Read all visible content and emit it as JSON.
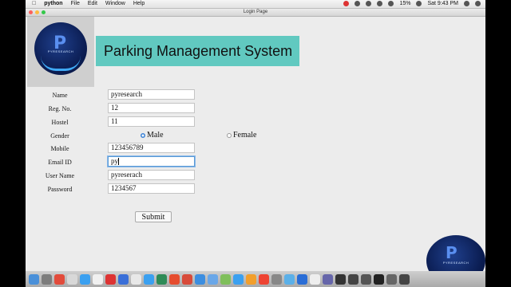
{
  "menubar": {
    "app": "python",
    "menus": [
      "File",
      "Edit",
      "Window",
      "Help"
    ],
    "battery": "15%",
    "clock": "Sat 9:43 PM"
  },
  "window": {
    "title": "Login Page"
  },
  "logo": {
    "letter": "P",
    "text": "PYRESEARCH"
  },
  "banner": {
    "title": "Parking Management System"
  },
  "form": {
    "name": {
      "label": "Name",
      "value": "pyresearch"
    },
    "regno": {
      "label": "Reg. No.",
      "value": "12"
    },
    "hostel": {
      "label": "Hostel",
      "value": "11"
    },
    "gender": {
      "label": "Gender",
      "options": [
        "Male",
        "Female"
      ],
      "selected": "Male"
    },
    "mobile": {
      "label": "Mobile",
      "value": "123456789"
    },
    "email": {
      "label": "Email ID",
      "value": "py"
    },
    "username": {
      "label": "User Name",
      "value": "pyreserach"
    },
    "password": {
      "label": "Password",
      "value": "1234567"
    },
    "submit_label": "Submit"
  },
  "dock": {
    "colors": [
      "#4a90d9",
      "#7d7d7d",
      "#e24b3b",
      "#d8d8d8",
      "#3ba0f0",
      "#f0f0f0",
      "#d33",
      "#3a6fd8",
      "#e8e8e8",
      "#3ba0f0",
      "#2e8b57",
      "#e64d2f",
      "#d84b3a",
      "#3c8ee0",
      "#6aa7e8",
      "#7fbf5b",
      "#3ba0f0",
      "#f29f2c",
      "#e43",
      "#888",
      "#5bb0e8",
      "#2a6dd6",
      "#eee",
      "#66a",
      "#333",
      "#444",
      "#555",
      "#222",
      "#666",
      "#444"
    ]
  }
}
